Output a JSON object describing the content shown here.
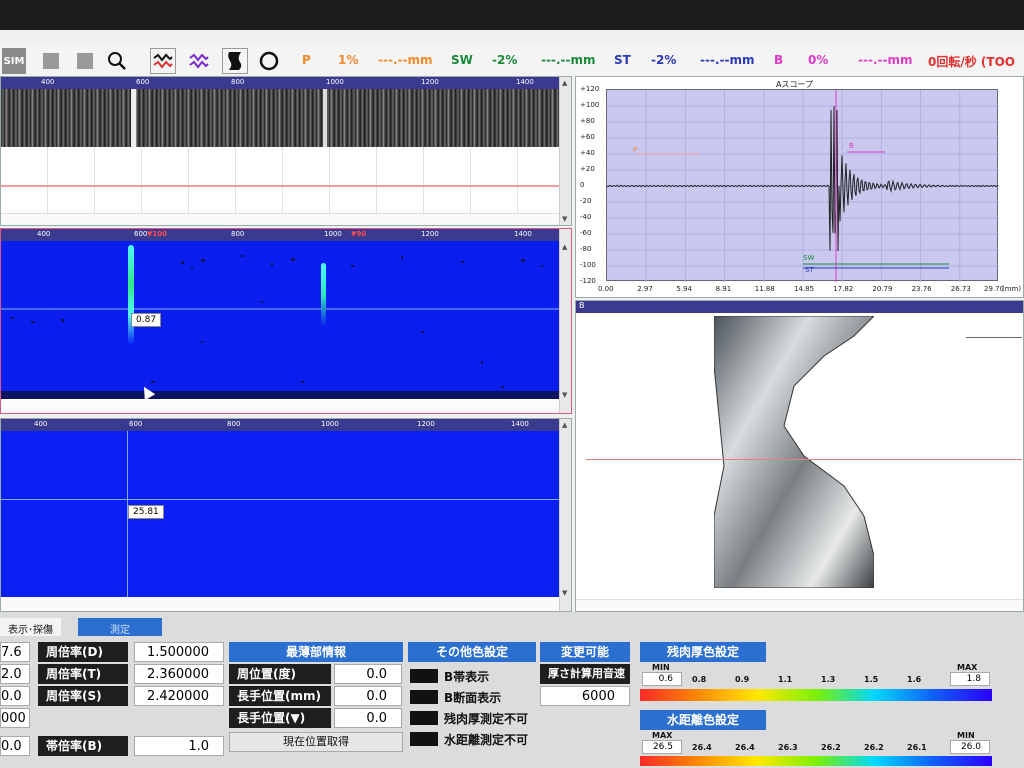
{
  "toolbar": {
    "sim": "SIM",
    "p_label": "P",
    "p_pct": "1%",
    "p_mm": "---.--mm",
    "sw_label": "SW",
    "sw_pct": "-2%",
    "sw_mm": "---.--mm",
    "st_label": "ST",
    "st_pct": "-2%",
    "st_mm": "---.--mm",
    "b_label": "B",
    "b_pct": "0%",
    "b_mm": "---.--mm",
    "rev": "0回転/秒 (TOO"
  },
  "rulers": {
    "top": [
      "600",
      "800",
      "1000",
      "1200",
      "1400",
      "400"
    ],
    "mid": [
      "400",
      "600",
      "800",
      "1000",
      "1200",
      "1400"
    ],
    "mid_markers": [
      "▼100",
      "▼90"
    ],
    "bot": [
      "400",
      "600",
      "800",
      "1000",
      "1200",
      "1400"
    ]
  },
  "cscan": {
    "value_label": "0.87"
  },
  "thick": {
    "value_label": "25.81"
  },
  "scope": {
    "title": "Aスコープ",
    "y_ticks": [
      "+120",
      "+100",
      "+80",
      "+60",
      "+40",
      "+20",
      "0",
      "-20",
      "-40",
      "-60",
      "-80",
      "-100",
      "-120"
    ],
    "x_ticks": [
      "0.00",
      "2.97",
      "5.94",
      "8.91",
      "11.88",
      "14.85",
      "17.82",
      "20.79",
      "23.76",
      "26.73",
      "29.70",
      "(mm)"
    ],
    "gate_p": "P",
    "gate_b": "B",
    "gate_sw": "SW",
    "gate_st": "ST"
  },
  "bview": {
    "label": "B"
  },
  "bottom": {
    "tab_display": "表示･探傷",
    "tab_measure": "測定",
    "left_values": [
      "7.6",
      "2.0",
      "0.0",
      "000",
      "0.0"
    ],
    "mag_d_label": "周倍率(D)",
    "mag_d": "1.500000",
    "mag_t_label": "周倍率(T)",
    "mag_t": "2.360000",
    "mag_s_label": "周倍率(S)",
    "mag_s": "2.420000",
    "band_label": "帯倍率(B)",
    "band": "1.0",
    "thin_header": "最薄部情報",
    "pos_deg_label": "周位置(度)",
    "pos_deg": "0.0",
    "pos_mm_label": "長手位置(mm)",
    "pos_mm": "0.0",
    "pos_tri_label": "長手位置(▼)",
    "pos_tri": "0.0",
    "get_pos_btn": "現在位置取得",
    "other_header": "その他色設定",
    "opt1": "B帯表示",
    "opt2": "B断面表示",
    "opt3": "残肉厚測定不可",
    "opt4": "水距離測定不可",
    "change_header": "変更可能",
    "calc_label": "厚さ計算用音速",
    "calc_val": "6000",
    "thick_color_header": "残肉厚色設定",
    "min_label": "MIN",
    "max_label": "MAX",
    "thick_min": "0.6",
    "thick_max": "1.8",
    "thick_scale": [
      "0.8",
      "0.9",
      "1.1",
      "1.3",
      "1.5",
      "1.6"
    ],
    "water_header": "水距離色設定",
    "water_max_label": "MAX",
    "water_min_label": "MIN",
    "water_max": "26.5",
    "water_min": "26.0",
    "water_scale": [
      "26.4",
      "26.4",
      "26.3",
      "26.2",
      "26.2",
      "26.1"
    ]
  },
  "colors": {
    "accent": "#2b6fd1",
    "field": "#0a1ef0",
    "scope_bg": "#c9c9ef"
  }
}
